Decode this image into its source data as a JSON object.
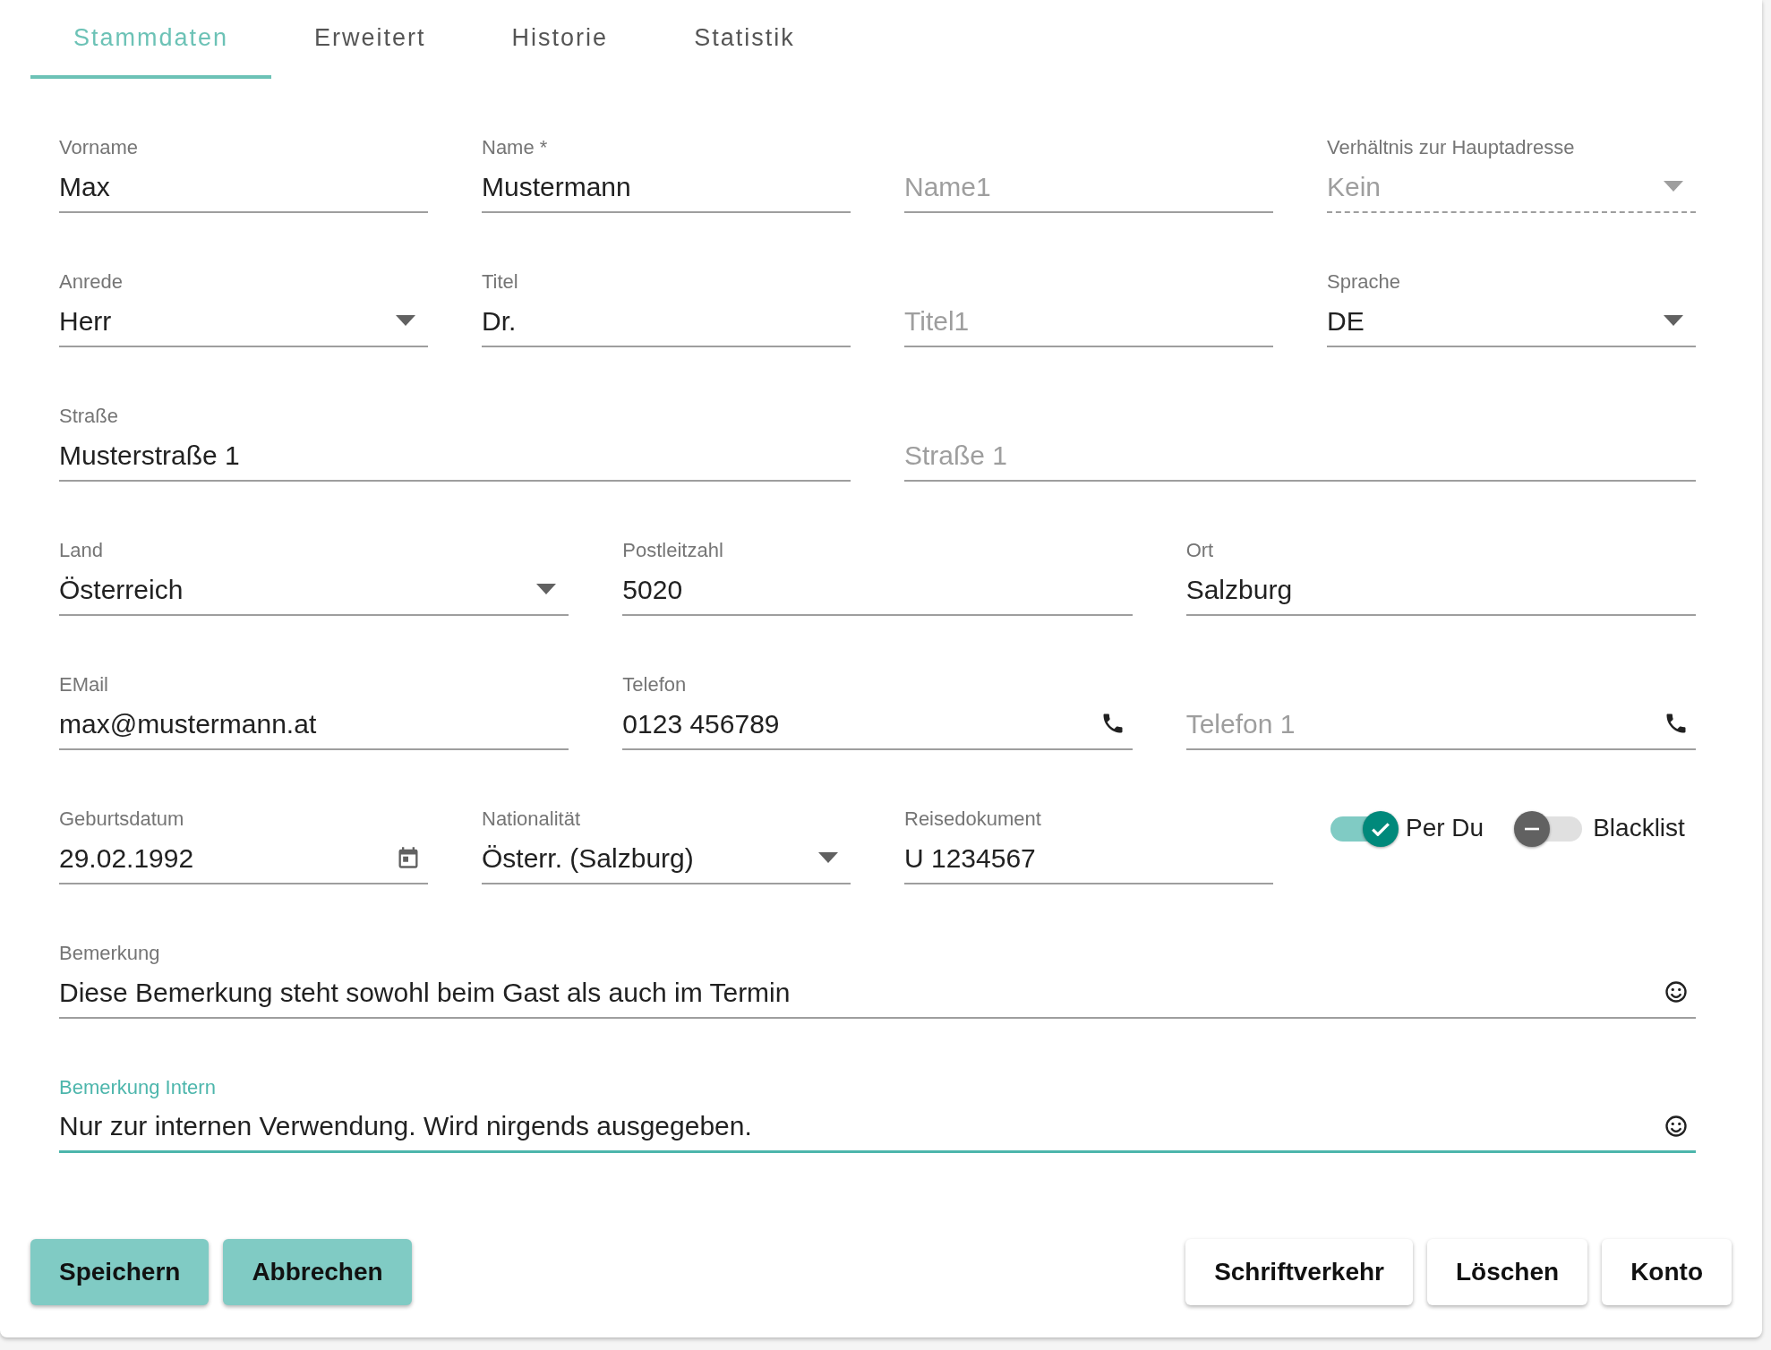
{
  "tabs": [
    {
      "label": "Stammdaten",
      "selected": true
    },
    {
      "label": "Erweitert",
      "selected": false
    },
    {
      "label": "Historie",
      "selected": false
    },
    {
      "label": "Statistik",
      "selected": false
    }
  ],
  "rows": [
    [
      {
        "kind": "text",
        "label": "Vorname",
        "value": "Max"
      },
      {
        "kind": "text",
        "label": "Name *",
        "value": "Mustermann"
      },
      {
        "kind": "text",
        "placeholder": "Name1"
      },
      {
        "kind": "select",
        "label": "Verhältnis zur Hauptadresse",
        "value": "Kein",
        "disabled": true
      }
    ],
    [
      {
        "kind": "select",
        "label": "Anrede",
        "value": "Herr"
      },
      {
        "kind": "text",
        "label": "Titel",
        "value": "Dr."
      },
      {
        "kind": "text",
        "placeholder": "Titel1"
      },
      {
        "kind": "select",
        "label": "Sprache",
        "value": "DE"
      }
    ],
    [
      {
        "kind": "text",
        "label": "Straße",
        "value": "Musterstraße 1"
      },
      {
        "kind": "text",
        "placeholder": "Straße 1"
      }
    ],
    [
      {
        "kind": "select",
        "label": "Land",
        "value": "Österreich"
      },
      {
        "kind": "text",
        "label": "Postleitzahl",
        "value": "5020"
      },
      {
        "kind": "text",
        "label": "Ort",
        "value": "Salzburg"
      }
    ],
    [
      {
        "kind": "text",
        "label": "EMail",
        "value": "max@mustermann.at"
      },
      {
        "kind": "phone",
        "label": "Telefon",
        "value": "0123 456789"
      },
      {
        "kind": "phone",
        "placeholder": "Telefon 1"
      }
    ],
    [
      {
        "kind": "date",
        "label": "Geburtsdatum",
        "value": "29.02.1992"
      },
      {
        "kind": "select",
        "label": "Nationalität",
        "value": "Österr. (Salzburg)"
      },
      {
        "kind": "text",
        "label": "Reisedokument",
        "value": "U 1234567"
      },
      {
        "kind": "toggles",
        "items": [
          {
            "label": "Per Du",
            "on": true
          },
          {
            "label": "Blacklist",
            "on": false
          }
        ]
      }
    ],
    [
      {
        "kind": "note",
        "label": "Bemerkung",
        "value": "Diese Bemerkung steht sowohl beim Gast als auch im Termin",
        "focused": false
      }
    ],
    [
      {
        "kind": "note",
        "label": "Bemerkung Intern",
        "value": "Nur zur internen Verwendung. Wird nirgends ausgegeben.",
        "focused": true
      }
    ]
  ],
  "actions": {
    "left": [
      {
        "label": "Speichern"
      },
      {
        "label": "Abbrechen"
      }
    ],
    "right": [
      {
        "label": "Schriftverkehr"
      },
      {
        "label": "Löschen"
      },
      {
        "label": "Konto"
      }
    ]
  }
}
